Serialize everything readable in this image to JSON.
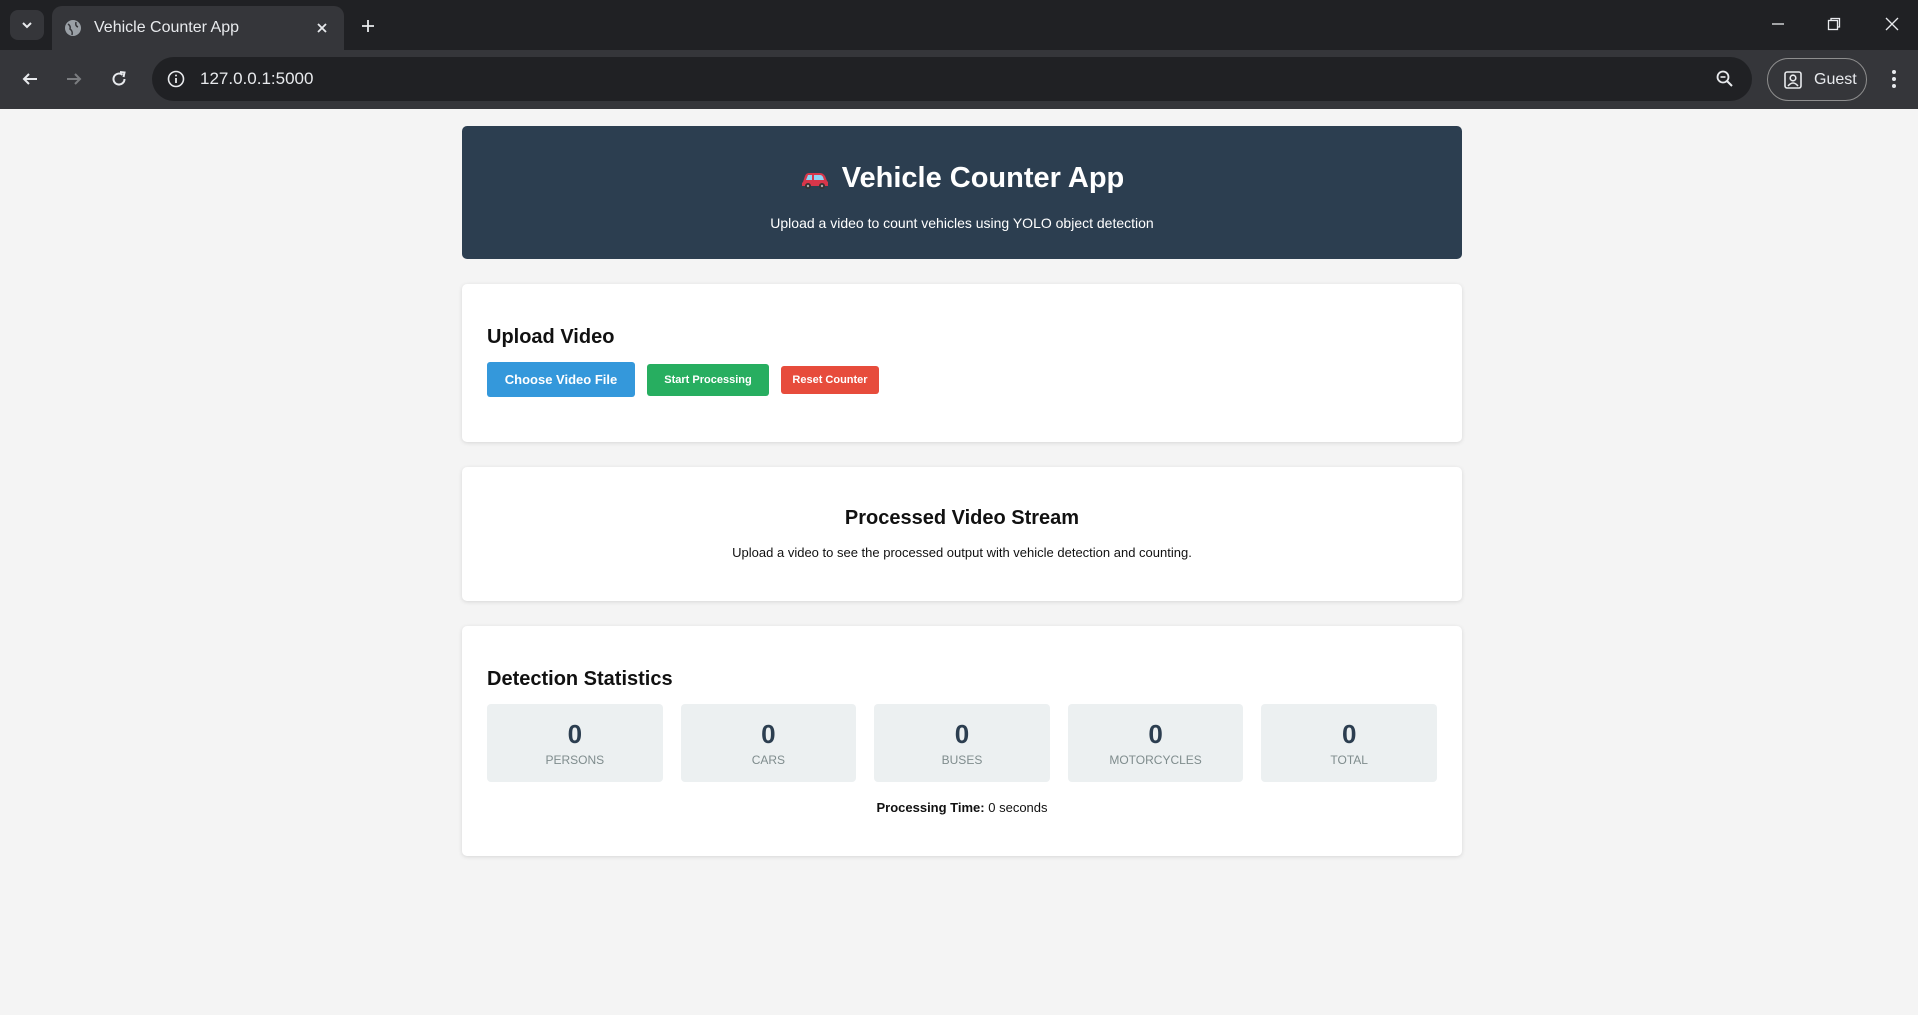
{
  "browser": {
    "tab_title": "Vehicle Counter App",
    "url": "127.0.0.1:5000",
    "profile_label": "Guest"
  },
  "header": {
    "title": "Vehicle Counter App",
    "subtitle": "Upload a video to count vehicles using YOLO object detection",
    "icon": "car-icon",
    "background_color": "#2c3e50"
  },
  "upload": {
    "heading": "Upload Video",
    "choose_label": "Choose Video File",
    "start_label": "Start Processing",
    "reset_label": "Reset Counter",
    "colors": {
      "choose": "#3498db",
      "start": "#27ae60",
      "reset": "#e74c3c"
    }
  },
  "stream": {
    "heading": "Processed Video Stream",
    "message": "Upload a video to see the processed output with vehicle detection and counting."
  },
  "stats": {
    "heading": "Detection Statistics",
    "items": [
      {
        "value": "0",
        "label": "PERSONS"
      },
      {
        "value": "0",
        "label": "CARS"
      },
      {
        "value": "0",
        "label": "BUSES"
      },
      {
        "value": "0",
        "label": "MOTORCYCLES"
      },
      {
        "value": "0",
        "label": "TOTAL"
      }
    ],
    "processing_time_label": "Processing Time:",
    "processing_time_value": "0 seconds"
  }
}
